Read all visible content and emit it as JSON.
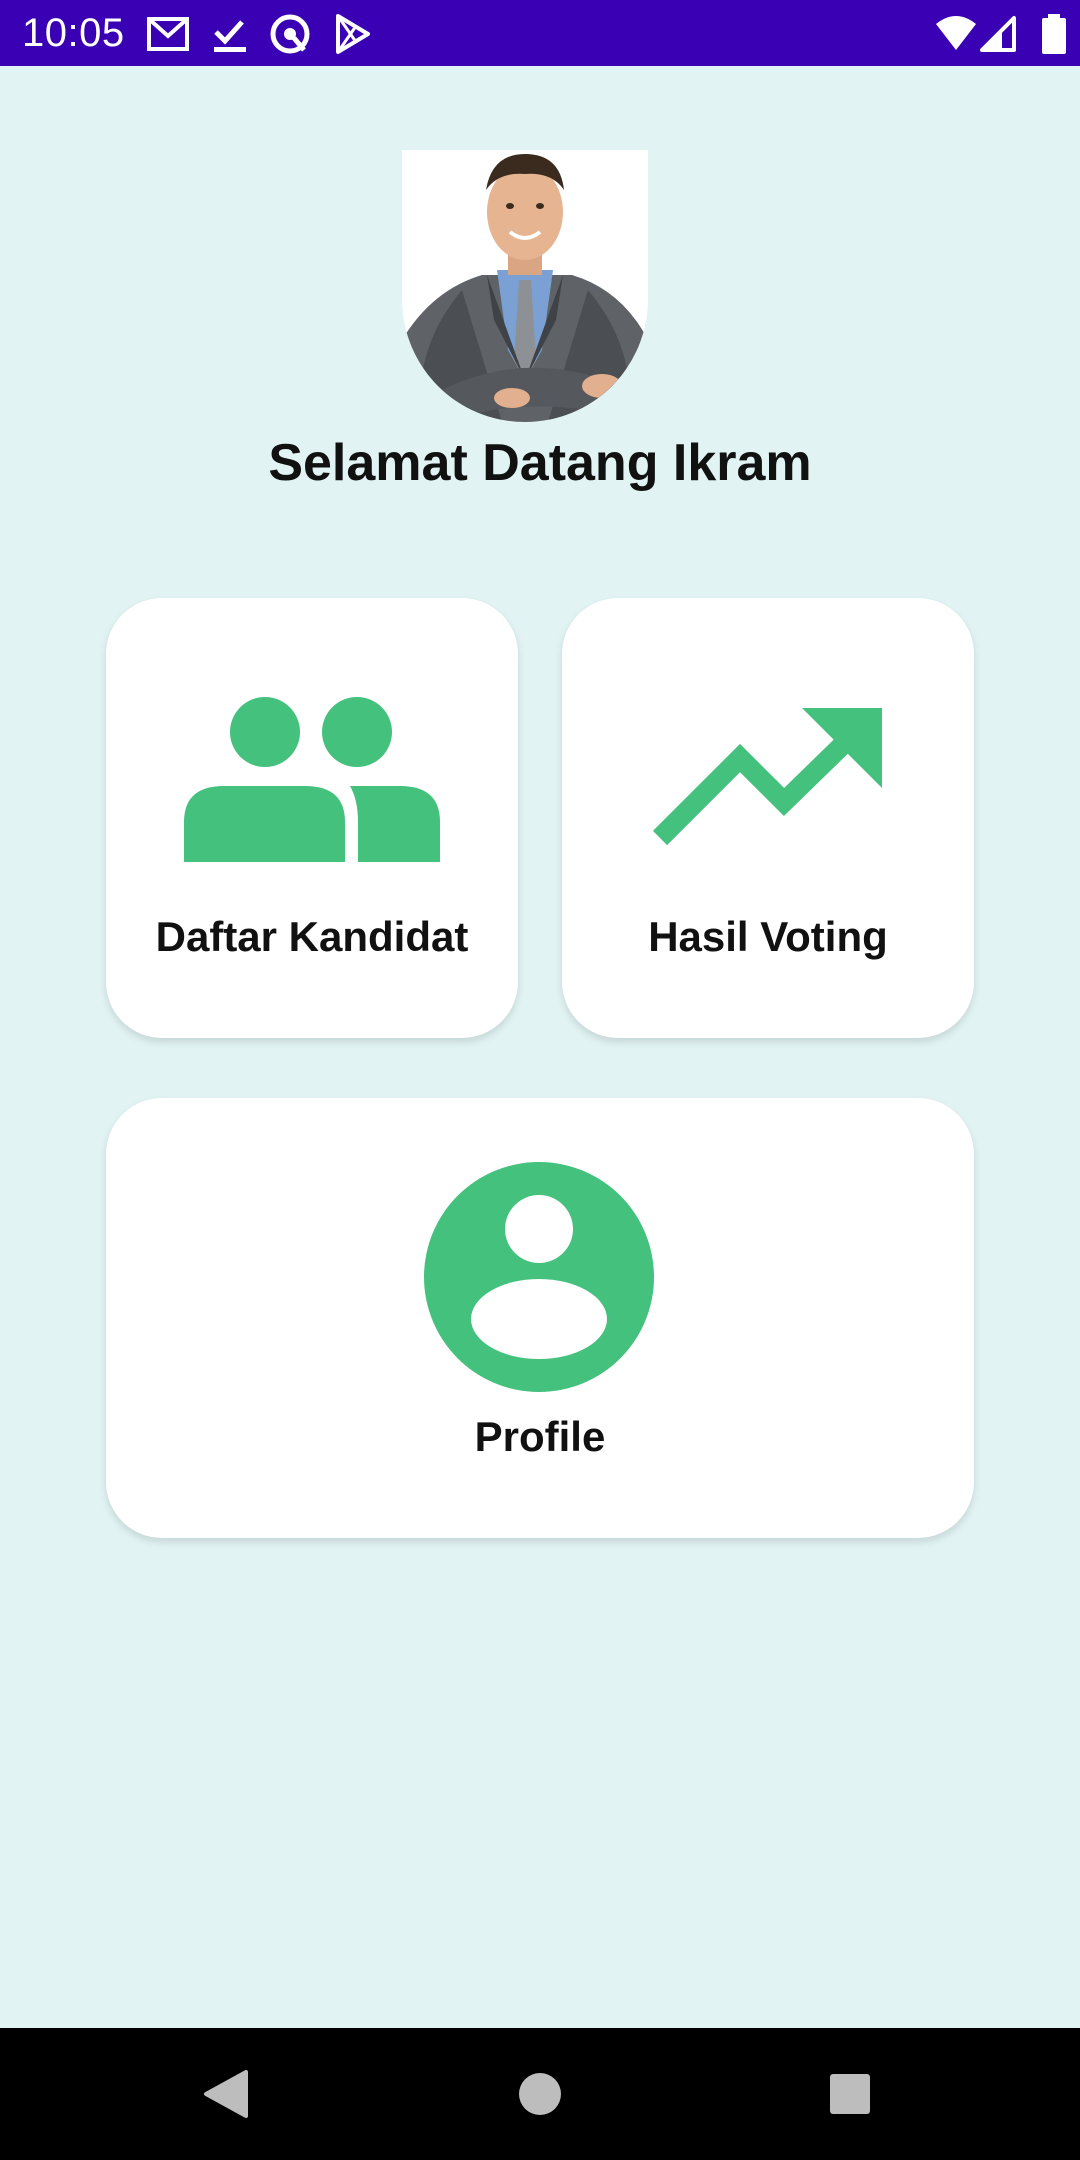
{
  "status_bar": {
    "time": "10:05",
    "notification_icons": [
      "gmail-icon",
      "task-done-icon",
      "vpn-icon",
      "play-store-icon"
    ],
    "system_icons": [
      "wifi-icon",
      "cell-signal-icon",
      "battery-icon"
    ],
    "background_color": "#3a00b4"
  },
  "main": {
    "welcome_text": "Selamat Datang Ikram",
    "avatar_icon": "user-photo",
    "cards": [
      {
        "label": "Daftar Kandidat",
        "icon": "people-icon"
      },
      {
        "label": "Hasil Voting",
        "icon": "trending-up-icon"
      },
      {
        "label": "Profile",
        "icon": "account-circle-icon"
      }
    ]
  },
  "colors": {
    "accent_green": "#43c17d",
    "background": "#e1f3f3",
    "card": "#ffffff"
  },
  "nav_bar": {
    "buttons": [
      "back-icon",
      "home-icon",
      "recents-icon"
    ]
  }
}
